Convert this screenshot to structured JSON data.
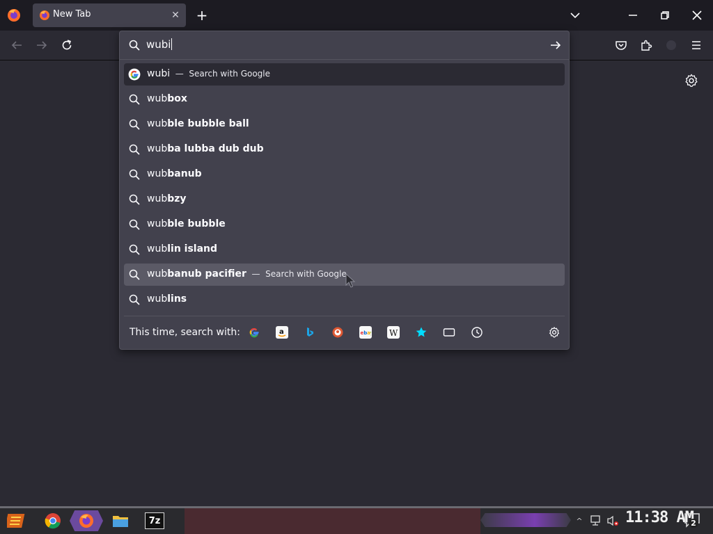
{
  "browser": {
    "tab": {
      "title": "New Tab"
    },
    "colors": {
      "accent": "#42414d",
      "frame": "#1c1b22",
      "page": "#2b2a33"
    }
  },
  "urlbar": {
    "value": "wubi",
    "results": [
      {
        "bold": "",
        "plain": "wubi",
        "action": "Search with Google",
        "icon": "google-icon",
        "state": "selected"
      },
      {
        "bold": "box",
        "plain": "wub",
        "action": "",
        "icon": "search-icon",
        "state": ""
      },
      {
        "bold": "ble bubble ball",
        "plain": "wub",
        "action": "",
        "icon": "search-icon",
        "state": ""
      },
      {
        "bold": "ba lubba dub dub",
        "plain": "wub",
        "action": "",
        "icon": "search-icon",
        "state": ""
      },
      {
        "bold": "banub",
        "plain": "wub",
        "action": "",
        "icon": "search-icon",
        "state": ""
      },
      {
        "bold": "bzy",
        "plain": "wub",
        "action": "",
        "icon": "search-icon",
        "state": ""
      },
      {
        "bold": "ble bubble",
        "plain": "wub",
        "action": "",
        "icon": "search-icon",
        "state": ""
      },
      {
        "bold": "lin island",
        "plain": "wub",
        "action": "",
        "icon": "search-icon",
        "state": ""
      },
      {
        "bold": "banub pacifier",
        "plain": "wub",
        "action": "Search with Google",
        "icon": "search-icon",
        "state": "hover"
      },
      {
        "bold": "lins",
        "plain": "wub",
        "action": "",
        "icon": "search-icon",
        "state": ""
      }
    ],
    "footer_label": "This time, search with:",
    "engines": [
      "google-icon",
      "amazon-icon",
      "bing-icon",
      "duckduckgo-icon",
      "ebay-icon",
      "wikipedia-icon",
      "bookmarks-star-icon",
      "tabs-icon",
      "history-clock-icon"
    ]
  },
  "taskbar": {
    "clock": "11:38 AM",
    "notification_count": "2",
    "apps": [
      "start-icon",
      "chrome-icon",
      "firefox-icon",
      "file-explorer-icon",
      "7zip-icon"
    ],
    "sevenzip_label": "7z"
  }
}
